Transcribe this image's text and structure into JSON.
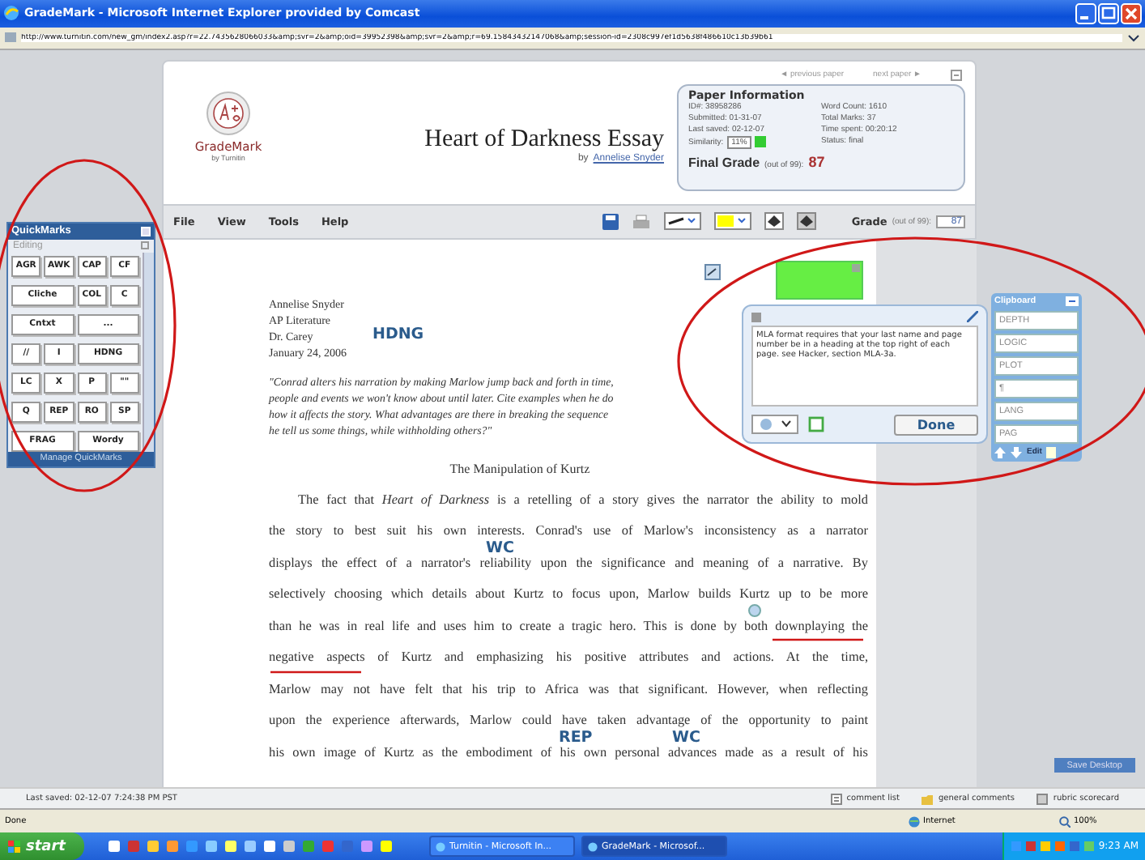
{
  "window": {
    "title": "GradeMark - Microsoft Internet Explorer provided by Comcast",
    "address": "http://www.turnitin.com/new_gm/index2.asp?r=22.7435628066033&amp;svr=2&amp;oid=39952398&amp;svr=2&amp;r=69.15843432147068&amp;session-id=2308c997ef1d5638f486610c13b39b61"
  },
  "paper_nav": {
    "previous": "◄ previous paper",
    "next": "next paper ►"
  },
  "logo": {
    "name": "GradeMark",
    "tagline": "by Turnitin"
  },
  "paper": {
    "title": "Heart of Darkness Essay",
    "by": "by",
    "author": "Annelise Snyder"
  },
  "paper_information": {
    "title": "Paper Information",
    "fields": [
      "ID#: 38958286",
      "Word Count: 1610",
      "Submitted: 01-31-07",
      "Total Marks: 37",
      "Last saved: 02-12-07",
      "Time spent: 00:20:12"
    ],
    "similarity_label": "Similarity:",
    "similarity": "11%",
    "status": "Status: final",
    "final_grade_label": "Final Grade",
    "final_grade_scale": "(out of 99):",
    "final_grade": "87"
  },
  "menu": [
    "File",
    "View",
    "Tools",
    "Help"
  ],
  "grade": {
    "label": "Grade",
    "scale": "(out of 99):",
    "value": "87"
  },
  "quickmarks": {
    "title": "QuickMarks",
    "set": "Editing",
    "buttons": [
      {
        "label": "AGR",
        "kind": "narrow"
      },
      {
        "label": "AWK",
        "kind": "narrow"
      },
      {
        "label": "CAP",
        "kind": "narrow"
      },
      {
        "label": "CF",
        "kind": "narrow"
      },
      {
        "label": "Cliche",
        "kind": "wide"
      },
      {
        "label": "COL",
        "kind": "narrow"
      },
      {
        "label": "C",
        "kind": "narrow"
      },
      {
        "label": "Cntxt",
        "kind": "wide"
      },
      {
        "label": "...",
        "kind": "wide"
      },
      {
        "label": "//",
        "kind": "narrow"
      },
      {
        "label": "I",
        "kind": "narrow"
      },
      {
        "label": "HDNG",
        "kind": "wide"
      },
      {
        "label": "LC",
        "kind": "narrow"
      },
      {
        "label": "X",
        "kind": "narrow"
      },
      {
        "label": "P",
        "kind": "narrow"
      },
      {
        "label": "\"\"",
        "kind": "narrow"
      },
      {
        "label": "Q",
        "kind": "narrow"
      },
      {
        "label": "REP",
        "kind": "narrow"
      },
      {
        "label": "RO",
        "kind": "narrow"
      },
      {
        "label": "SP",
        "kind": "narrow"
      },
      {
        "label": "FRAG",
        "kind": "wide"
      },
      {
        "label": "Wordy",
        "kind": "wide"
      }
    ],
    "footer": "Manage QuickMarks"
  },
  "document": {
    "header_lines": [
      "Annelise Snyder",
      "AP Literature",
      "Dr. Carey",
      "January 24, 2006"
    ],
    "prompt_lines": [
      "\"Conrad alters his narration by making Marlow jump back and forth in time,",
      "people and events we won't know about until later. Cite examples when he do",
      "how it affects the story. What advantages are there in breaking the sequence",
      "he tell us some things, while withholding others?\""
    ],
    "heading": "The Manipulation of Kurtz",
    "body_lines": [
      "The fact that *Heart of Darkness* is a retelling of a story gives the narrator the ability to mold",
      "the story to best suit his own interests. Conrad's use of Marlow's inconsistency as a narrator",
      "displays the effect of a narrator's reliability upon the significance and meaning of a narrative. By",
      "selectively choosing which details about Kurtz to focus upon, Marlow builds Kurtz up to be more",
      "than he was in real life and uses him to create a tragic hero. This is done by both downplaying the",
      "negative aspects of Kurtz and emphasizing his positive attributes and actions. At the time,",
      "Marlow may not have felt that his trip to Africa was that significant. However, when reflecting",
      "upon the experience afterwards, Marlow could have taken advantage of the opportunity to paint",
      "his own image of Kurtz as the embodiment of his own personal advances made as a result of his"
    ],
    "marks": [
      "HDNG",
      "WC",
      "REP",
      "WC"
    ]
  },
  "comment": {
    "text": "MLA format requires that your last name and page number be in a heading at the top right of each page. see Hacker, section MLA-3a.",
    "button": "Done"
  },
  "clipboard": {
    "title": "Clipboard",
    "items": [
      "DEPTH",
      "LOGIC",
      "PLOT",
      "¶",
      "LANG",
      "PAG"
    ],
    "edit": "Edit"
  },
  "save_desktop": "Save Desktop",
  "app_status": {
    "last_saved": "Last saved: 02-12-07 7:24:38 PM PST",
    "tabs": [
      "comment list",
      "general comments",
      "rubric scorecard"
    ]
  },
  "ie_status": {
    "text": "Done",
    "zone": "Internet",
    "zoom": "100%"
  },
  "taskbar": {
    "start": "start",
    "tasks": [
      {
        "label": "Turnitin - Microsoft In...",
        "selected": false
      },
      {
        "label": "GradeMark - Microsof...",
        "selected": true
      }
    ],
    "clock": "9:23 AM"
  },
  "annotations": [
    {
      "kind": "ellipse"
    },
    {
      "kind": "ellipse"
    },
    {
      "kind": "underline"
    },
    {
      "kind": "underline"
    }
  ]
}
